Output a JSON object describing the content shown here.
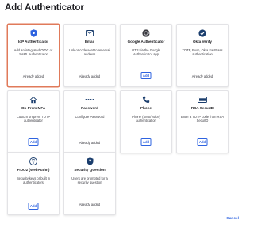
{
  "dialog": {
    "title": "Add Authenticator",
    "cancel_label": "Cancel"
  },
  "colors": {
    "accent": "#2e63e0",
    "icon_dark": "#1a3d6d",
    "selected_border": "#e07a5a"
  },
  "cards": [
    {
      "name": "IdP Authenticator",
      "desc": "Add an integrated OIDC or SAML authenticator",
      "status": "Already added",
      "icon": "shield-icon"
    },
    {
      "name": "Email",
      "desc": "Link or code sent to an email address",
      "status": "Already added",
      "icon": "envelope-icon"
    },
    {
      "name": "Google Authenticator",
      "desc": "OTP via the Google Authenticator app",
      "button": "Add",
      "icon": "google-authenticator-icon"
    },
    {
      "name": "Okta Verify",
      "desc": "TOTP, Push, Okta FastPass authentication",
      "status": "Already added",
      "icon": "okta-verify-icon"
    },
    {
      "name": "On-Prem MFA",
      "desc": "Custom on-prem TOTP authenticator",
      "button": "Add",
      "icon": "on-prem-mfa-icon"
    },
    {
      "name": "Password",
      "desc": "Configure Password",
      "status": "Already added",
      "icon": "password-icon"
    },
    {
      "name": "Phone",
      "desc": "Phone (SMS/Voice) authentication",
      "button": "Add",
      "icon": "phone-icon"
    },
    {
      "name": "RSA SecurID",
      "desc": "Enter a TOTP code from RSA SecurID",
      "button": "Add",
      "icon": "rsa-securid-icon"
    },
    {
      "name": "FIDO2 (WebAuthn)",
      "desc": "Security keys or built in authenticators",
      "button": "Add",
      "icon": "fido2-icon"
    },
    {
      "name": "Security Question",
      "desc": "Users are prompted for a security question",
      "status": "Already added",
      "icon": "security-question-icon"
    }
  ]
}
